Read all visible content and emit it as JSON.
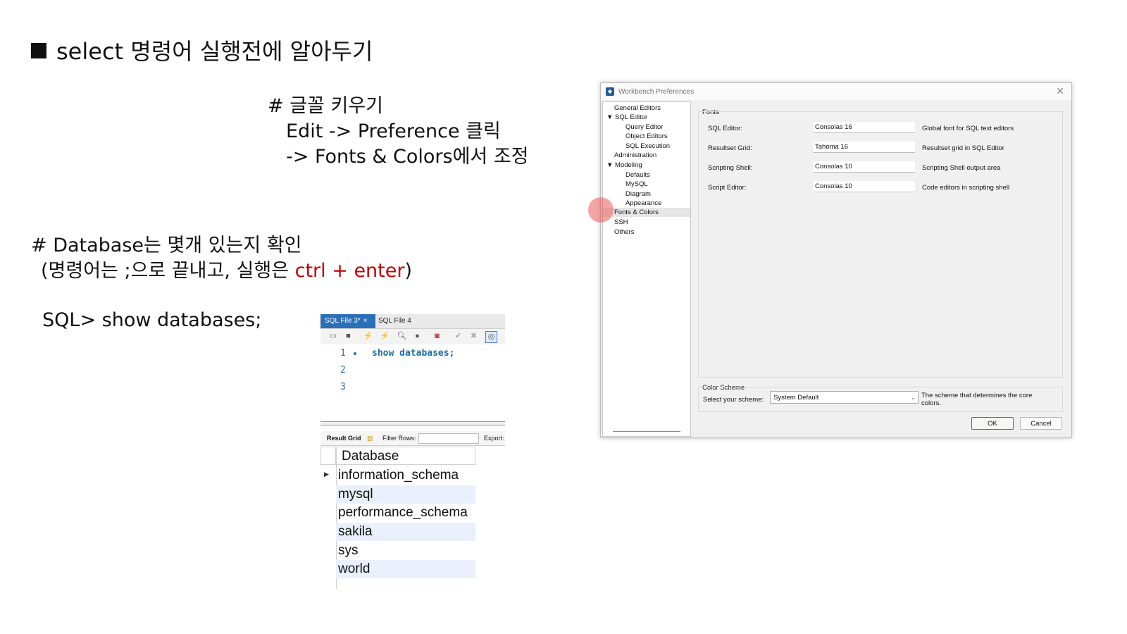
{
  "slide": {
    "title": "select 명령어 실행전에 알아두기",
    "font_note": [
      "# 글꼴 키우기",
      "Edit -> Preference 클릭",
      "-> Fonts & Colors에서 조정"
    ],
    "db_note_line1": "# Database는 몇개 있는지 확인",
    "db_note_line2_prefix": "(명령어는 ;으로 끝내고, 실행은 ",
    "db_note_line2_highlight": "ctrl + enter",
    "db_note_line2_suffix": ")",
    "sql_command": "SQL> show databases;",
    "highlight_color": "#c00000"
  },
  "editor": {
    "tabs": [
      {
        "label": "SQL File 3*",
        "close": "×"
      },
      {
        "label": "SQL File 4"
      }
    ],
    "line_numbers": [
      "1",
      "2",
      "3"
    ],
    "code_line1": "show databases;",
    "result_bar": {
      "result_grid": "Result Grid",
      "filter_rows": "Filter Rows:",
      "export": "Export:"
    },
    "grid_header": "Database",
    "rows": [
      "information_schema",
      "mysql",
      "performance_schema",
      "sakila",
      "sys",
      "world"
    ]
  },
  "dialog": {
    "title": "Workbench Preferences",
    "close": "✕",
    "tree": {
      "general_editors": "General Editors",
      "sql_editor": "SQL Editor",
      "query_editor": "Query Editor",
      "object_editors": "Object Editors",
      "sql_execution": "SQL Execution",
      "administration": "Administration",
      "modeling": "Modeling",
      "defaults": "Defaults",
      "mysql": "MySQL",
      "diagram": "Diagram",
      "appearance": "Appearance",
      "fonts_colors": "Fonts & Colors",
      "ssh": "SSH",
      "others": "Others"
    },
    "fonts_group_label": "Fonts",
    "fonts": [
      {
        "label": "SQL Editor:",
        "value": "Consolas 16",
        "desc": "Global font for SQL text editors"
      },
      {
        "label": "Resultset Grid:",
        "value": "Tahoma 16",
        "desc": "Resultset grid in SQL Editor"
      },
      {
        "label": "Scripting Shell:",
        "value": "Consolas 10",
        "desc": "Scripting Shell output area"
      },
      {
        "label": "Script Editor:",
        "value": "Consolas 10",
        "desc": "Code editors in scripting shell"
      }
    ],
    "color_scheme_label": "Color Scheme",
    "scheme_select_label": "Select your scheme:",
    "scheme_value": "System Default",
    "scheme_desc": "The scheme that determines the core colors.",
    "ok": "OK",
    "cancel": "Cancel"
  }
}
